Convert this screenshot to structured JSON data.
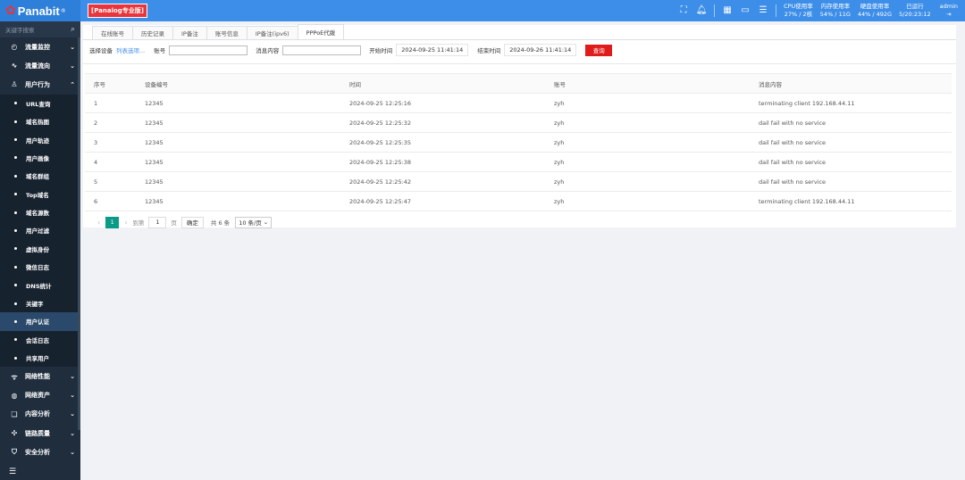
{
  "header": {
    "brand": "Panabit",
    "edition": "[Panalog专业版]",
    "stats": [
      {
        "label": "CPU使用率",
        "value": "27% / 2核"
      },
      {
        "label": "内存使用率",
        "value": "54% / 11G"
      },
      {
        "label": "硬盘使用率",
        "value": "44% / 492G"
      },
      {
        "label": "已运行",
        "value": "5/20:23:12"
      }
    ],
    "user": "admin",
    "colors": {
      "bar": "#3d8ee8",
      "edition": "#e8343a"
    }
  },
  "sidebar": {
    "search_placeholder": "关键字搜索",
    "top_items": [
      {
        "label": "流量监控",
        "icon": "gauge-icon"
      },
      {
        "label": "流量流向",
        "icon": "pulse-icon"
      },
      {
        "label": "用户行为",
        "icon": "user-icon"
      }
    ],
    "sub_items": [
      "URL查询",
      "域名热图",
      "用户轨迹",
      "用户画像",
      "域名群组",
      "Top域名",
      "域名源数",
      "用户过滤",
      "虚拟身份",
      "微信日志",
      "DNS统计",
      "关键字",
      "用户认证",
      "会话日志",
      "共享用户"
    ],
    "active_sub": "用户认证",
    "bottom_items": [
      {
        "label": "网络性能",
        "icon": "wifi-icon"
      },
      {
        "label": "网络资产",
        "icon": "globe-icon"
      },
      {
        "label": "内容分析",
        "icon": "book-icon"
      },
      {
        "label": "链路质量",
        "icon": "network-icon"
      },
      {
        "label": "安全分析",
        "icon": "shield-icon"
      }
    ]
  },
  "tabs": [
    "在线账号",
    "历史记录",
    "IP备注",
    "账号信息",
    "IP备注(ipv6)",
    "PPPoE代拨"
  ],
  "active_tab": "PPPoE代拨",
  "filters": {
    "device_label": "选择设备",
    "device_link": "列表选项...",
    "account_label": "账号",
    "account_value": "",
    "message_label": "消息内容",
    "message_value": "",
    "start_label": "开始时间",
    "start_value": "2024-09-25 11:41:14",
    "end_label": "结束时间",
    "end_value": "2024-09-26 11:41:14",
    "query_button": "查询"
  },
  "table": {
    "columns": [
      "序号",
      "设备编号",
      "时间",
      "账号",
      "消息内容"
    ],
    "rows": [
      [
        "1",
        "12345",
        "2024-09-25 12:25:16",
        "zyh",
        "terminating client 192.168.44.11"
      ],
      [
        "2",
        "12345",
        "2024-09-25 12:25:32",
        "zyh",
        "dail fail with no service"
      ],
      [
        "3",
        "12345",
        "2024-09-25 12:25:35",
        "zyh",
        "dail fail with no service"
      ],
      [
        "4",
        "12345",
        "2024-09-25 12:25:38",
        "zyh",
        "dail fail with no service"
      ],
      [
        "5",
        "12345",
        "2024-09-25 12:25:42",
        "zyh",
        "dail fail with no service"
      ],
      [
        "6",
        "12345",
        "2024-09-25 12:25:47",
        "zyh",
        "terminating client 192.168.44.11"
      ]
    ]
  },
  "pagination": {
    "current": "1",
    "goto_label": "到第",
    "goto_value": "1",
    "page_unit": "页",
    "confirm": "确定",
    "total": "共 6 条",
    "page_size": "10 条/页"
  }
}
